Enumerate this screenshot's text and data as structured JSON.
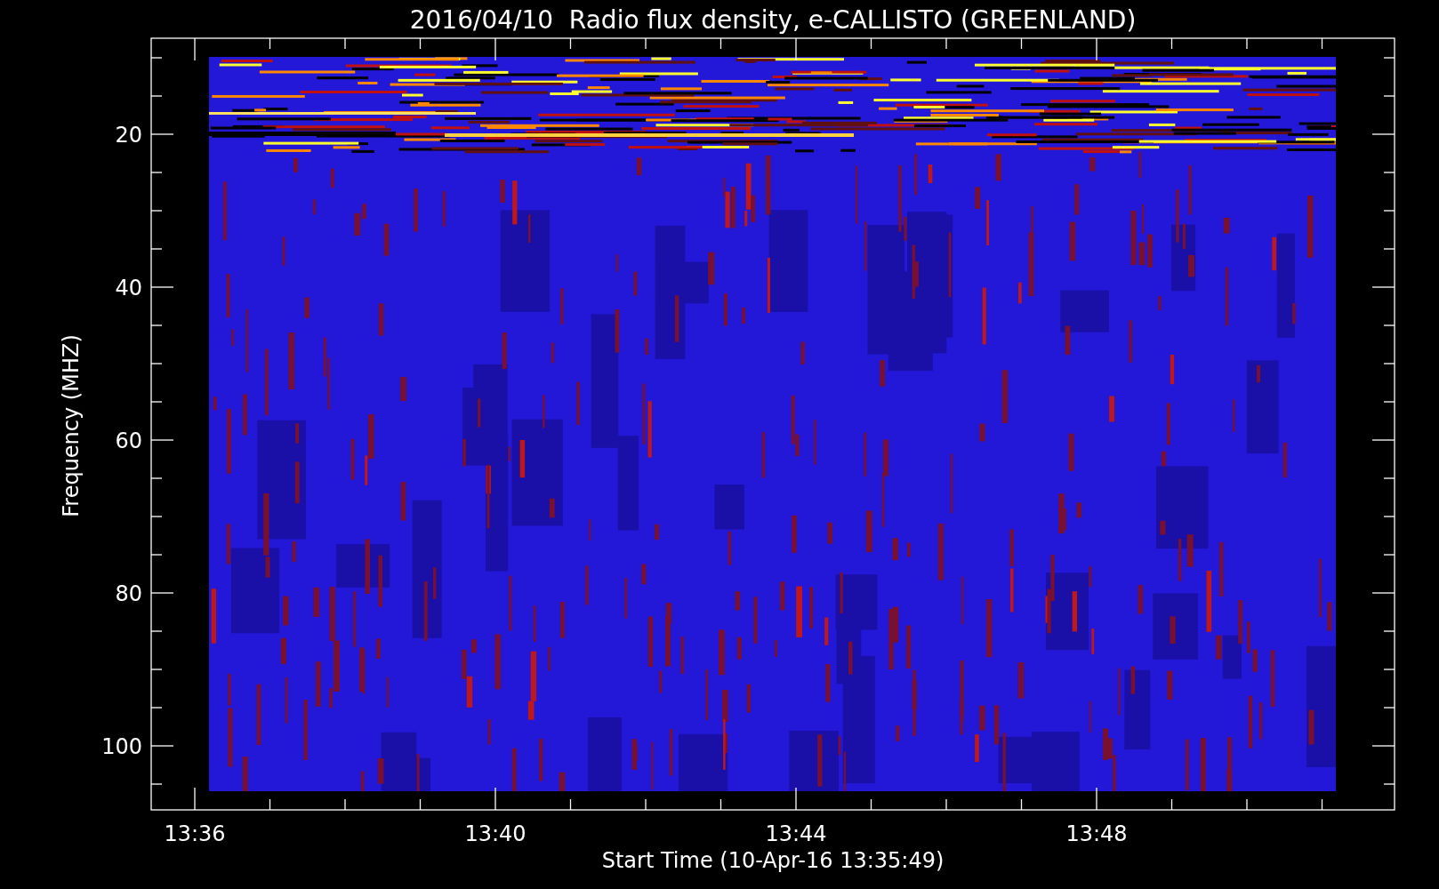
{
  "title": "2016/04/10  Radio flux density, e-CALLISTO (GREENLAND)",
  "x_axis": {
    "label": "Start Time (10-Apr-16 13:35:49)",
    "ticks": [
      "13:36",
      "13:40",
      "13:44",
      "13:48"
    ]
  },
  "y_axis": {
    "label": "Frequency (MHZ)",
    "ticks": [
      "20",
      "40",
      "60",
      "80",
      "100"
    ]
  }
}
